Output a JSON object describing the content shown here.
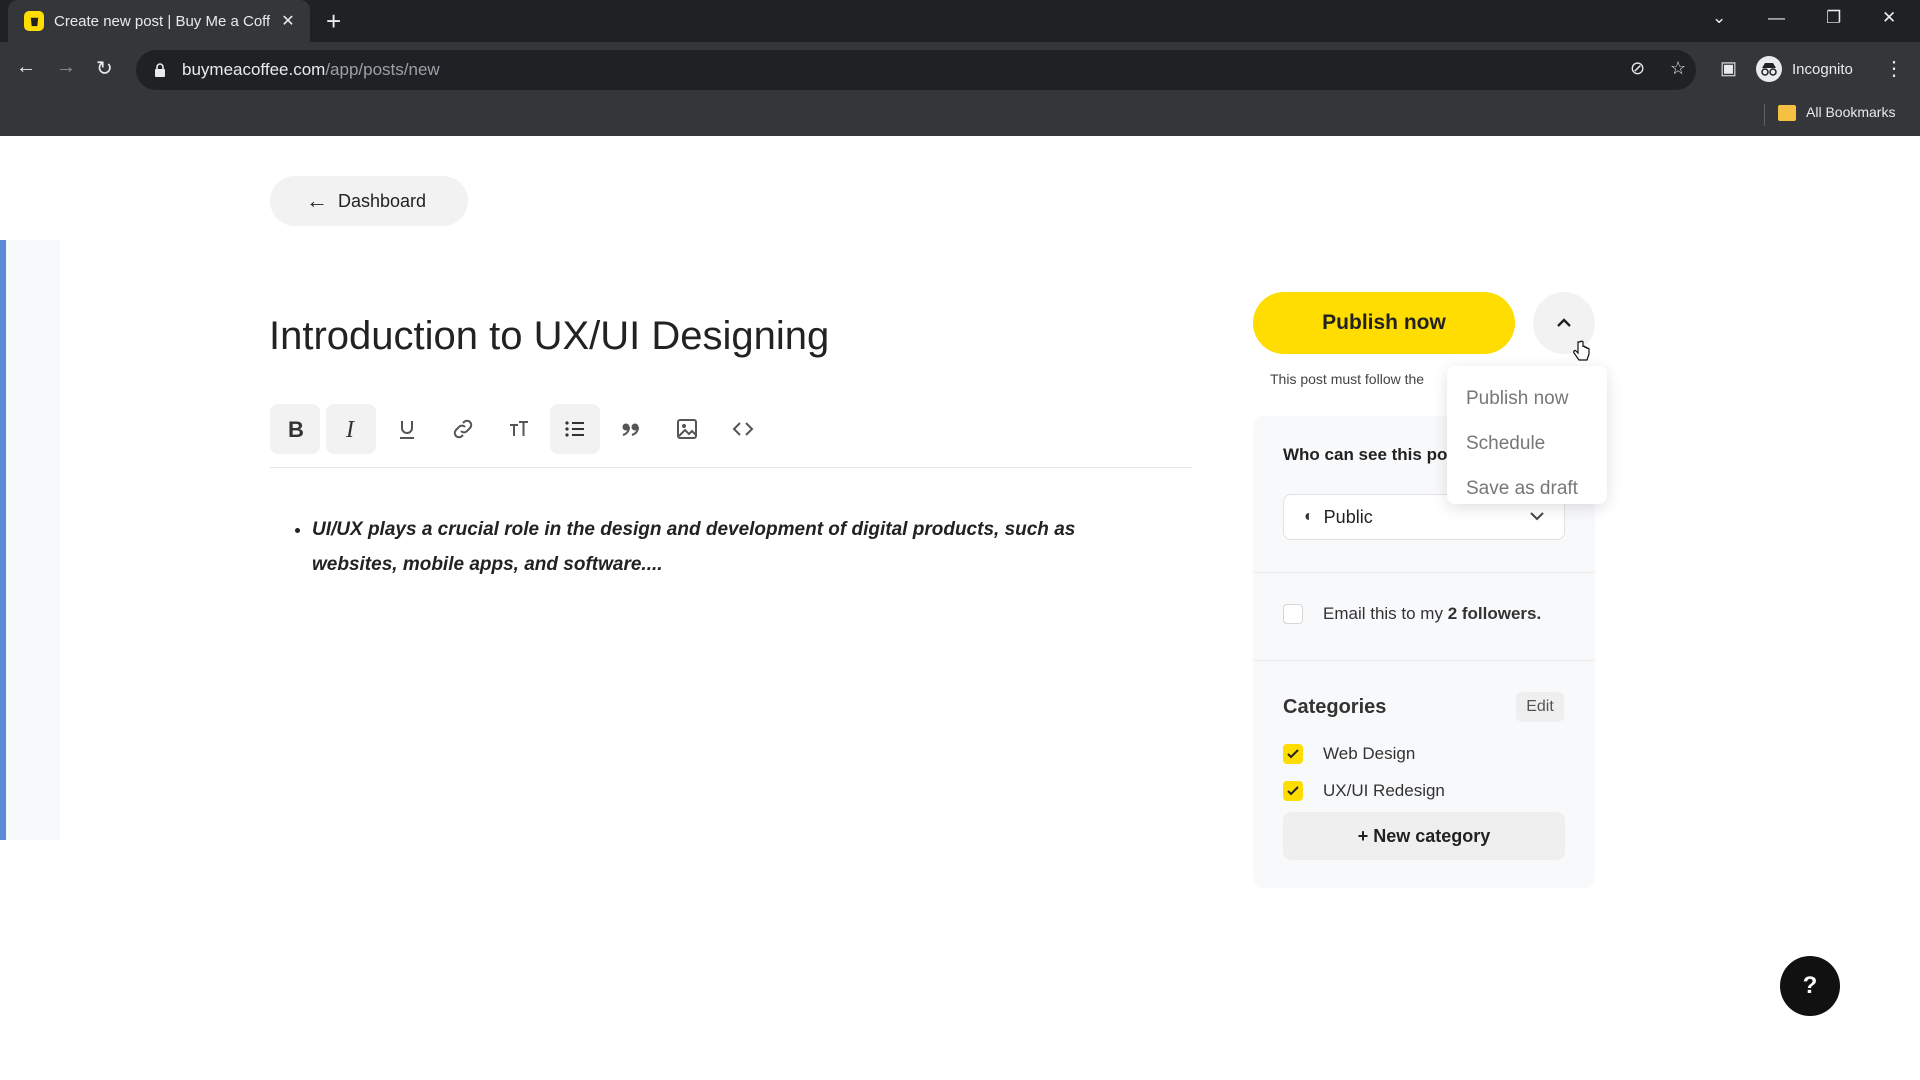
{
  "browser": {
    "tab_title": "Create new post | Buy Me a Coffee",
    "url_host": "buymeacoffee.com",
    "url_path": "/app/posts/new",
    "profile_label": "Incognito",
    "bookmarks_label": "All Bookmarks"
  },
  "page": {
    "back_label": "Dashboard",
    "post_title": "Introduction to UX/UI Designing",
    "body_text": "UI/UX plays a crucial role in the design and development of digital products, such as websites, mobile apps, and software...."
  },
  "toolbar": {
    "buttons": [
      "bold-icon",
      "italic-icon",
      "underline-icon",
      "link-icon",
      "text-size-icon",
      "bullet-list-icon",
      "quote-icon",
      "image-icon",
      "code-icon"
    ]
  },
  "sidebar": {
    "publish_label": "Publish now",
    "follow_note": "This post must follow the",
    "who_label": "Who can see this po",
    "visibility_value": "Public",
    "email_prefix": "Email this to my ",
    "email_count": "2 followers.",
    "categories_title": "Categories",
    "edit_label": "Edit",
    "categories": [
      {
        "label": "Web Design",
        "checked": true
      },
      {
        "label": "UX/UI Redesign",
        "checked": true
      }
    ],
    "new_category_label": "+ New category"
  },
  "dropdown": {
    "items": [
      "Publish now",
      "Schedule",
      "Save as draft"
    ]
  },
  "help_label": "?",
  "colors": {
    "accent_yellow": "#ffdd00",
    "chrome_dark": "#202124",
    "chrome_toolbar": "#35363a"
  }
}
